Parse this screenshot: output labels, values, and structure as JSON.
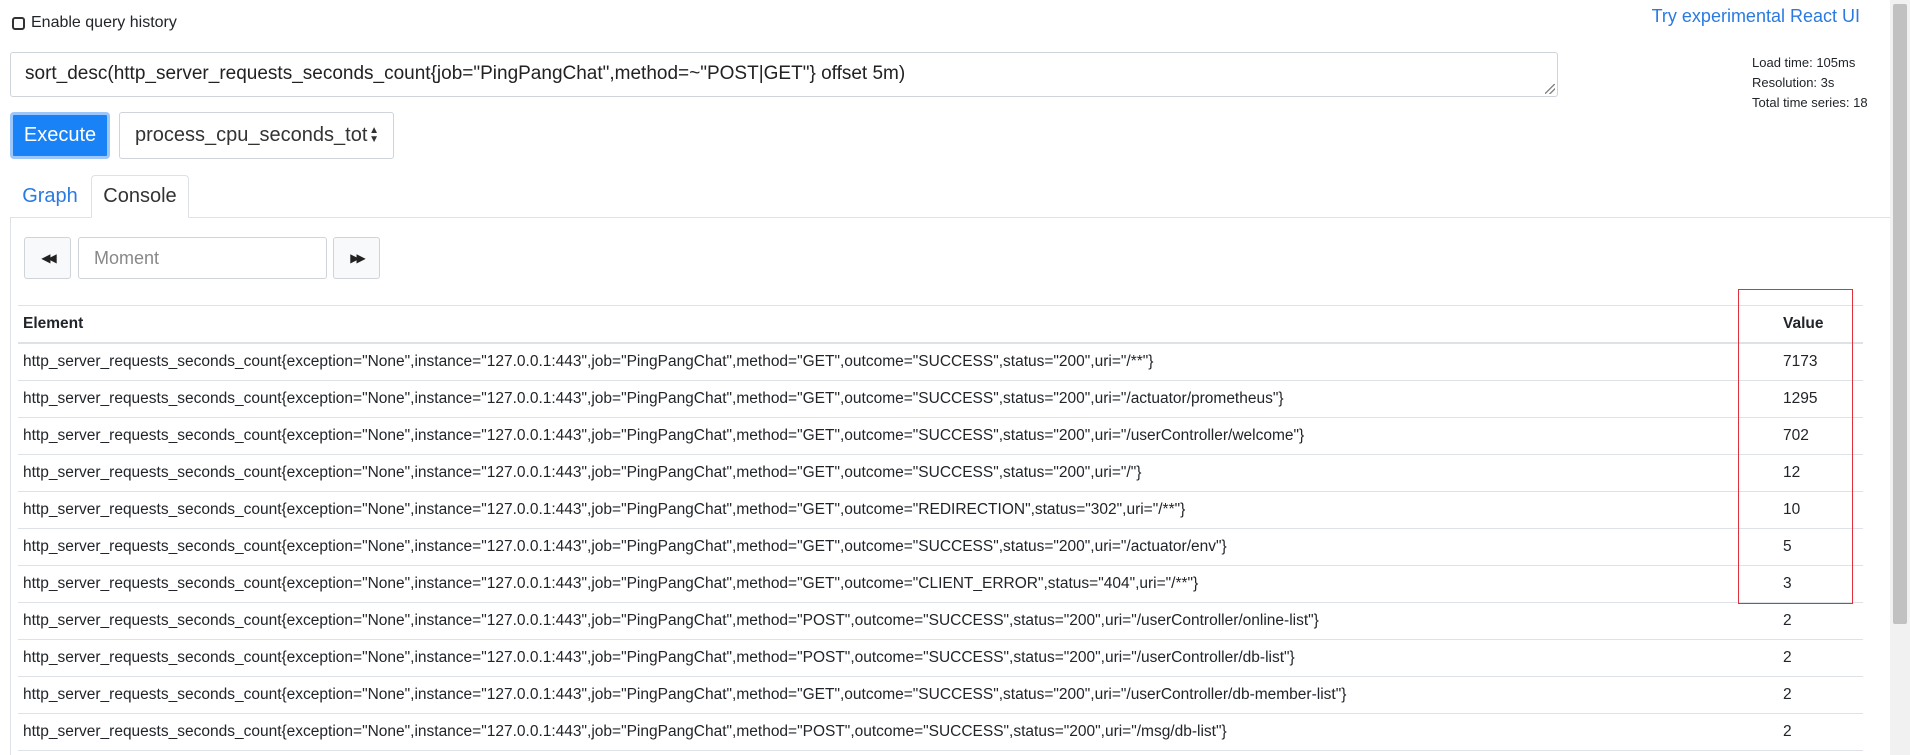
{
  "header": {
    "history_label": "Enable query history",
    "react_link": "Try experimental React UI"
  },
  "stats": {
    "load_time": "Load time: 105ms",
    "resolution": "Resolution: 3s",
    "total_series": "Total time series: 18"
  },
  "query": {
    "expression": "sort_desc(http_server_requests_seconds_count{job=\"PingPangChat\",method=~\"POST|GET\"} offset 5m)"
  },
  "controls": {
    "execute_label": "Execute",
    "metric_selected": "process_cpu_seconds_tot"
  },
  "tabs": {
    "graph": "Graph",
    "console": "Console"
  },
  "console": {
    "moment_placeholder": "Moment",
    "columns": [
      "Element",
      "Value"
    ],
    "rows": [
      {
        "element": "http_server_requests_seconds_count{exception=\"None\",instance=\"127.0.0.1:443\",job=\"PingPangChat\",method=\"GET\",outcome=\"SUCCESS\",status=\"200\",uri=\"/**\"}",
        "value": "7173"
      },
      {
        "element": "http_server_requests_seconds_count{exception=\"None\",instance=\"127.0.0.1:443\",job=\"PingPangChat\",method=\"GET\",outcome=\"SUCCESS\",status=\"200\",uri=\"/actuator/prometheus\"}",
        "value": "1295"
      },
      {
        "element": "http_server_requests_seconds_count{exception=\"None\",instance=\"127.0.0.1:443\",job=\"PingPangChat\",method=\"GET\",outcome=\"SUCCESS\",status=\"200\",uri=\"/userController/welcome\"}",
        "value": "702"
      },
      {
        "element": "http_server_requests_seconds_count{exception=\"None\",instance=\"127.0.0.1:443\",job=\"PingPangChat\",method=\"GET\",outcome=\"SUCCESS\",status=\"200\",uri=\"/\"}",
        "value": "12"
      },
      {
        "element": "http_server_requests_seconds_count{exception=\"None\",instance=\"127.0.0.1:443\",job=\"PingPangChat\",method=\"GET\",outcome=\"REDIRECTION\",status=\"302\",uri=\"/**\"}",
        "value": "10"
      },
      {
        "element": "http_server_requests_seconds_count{exception=\"None\",instance=\"127.0.0.1:443\",job=\"PingPangChat\",method=\"GET\",outcome=\"SUCCESS\",status=\"200\",uri=\"/actuator/env\"}",
        "value": "5"
      },
      {
        "element": "http_server_requests_seconds_count{exception=\"None\",instance=\"127.0.0.1:443\",job=\"PingPangChat\",method=\"GET\",outcome=\"CLIENT_ERROR\",status=\"404\",uri=\"/**\"}",
        "value": "3"
      },
      {
        "element": "http_server_requests_seconds_count{exception=\"None\",instance=\"127.0.0.1:443\",job=\"PingPangChat\",method=\"POST\",outcome=\"SUCCESS\",status=\"200\",uri=\"/userController/online-list\"}",
        "value": "2"
      },
      {
        "element": "http_server_requests_seconds_count{exception=\"None\",instance=\"127.0.0.1:443\",job=\"PingPangChat\",method=\"POST\",outcome=\"SUCCESS\",status=\"200\",uri=\"/userController/db-list\"}",
        "value": "2"
      },
      {
        "element": "http_server_requests_seconds_count{exception=\"None\",instance=\"127.0.0.1:443\",job=\"PingPangChat\",method=\"GET\",outcome=\"SUCCESS\",status=\"200\",uri=\"/userController/db-member-list\"}",
        "value": "2"
      },
      {
        "element": "http_server_requests_seconds_count{exception=\"None\",instance=\"127.0.0.1:443\",job=\"PingPangChat\",method=\"POST\",outcome=\"SUCCESS\",status=\"200\",uri=\"/msg/db-list\"}",
        "value": "2"
      }
    ]
  },
  "icons": {
    "prev": "fast-backward-icon",
    "next": "fast-forward-icon",
    "select_caret": "sort-caret-icon"
  },
  "colors": {
    "accent": "#1a82f7",
    "link": "#2a7ae2",
    "highlight": "#e0303a"
  }
}
